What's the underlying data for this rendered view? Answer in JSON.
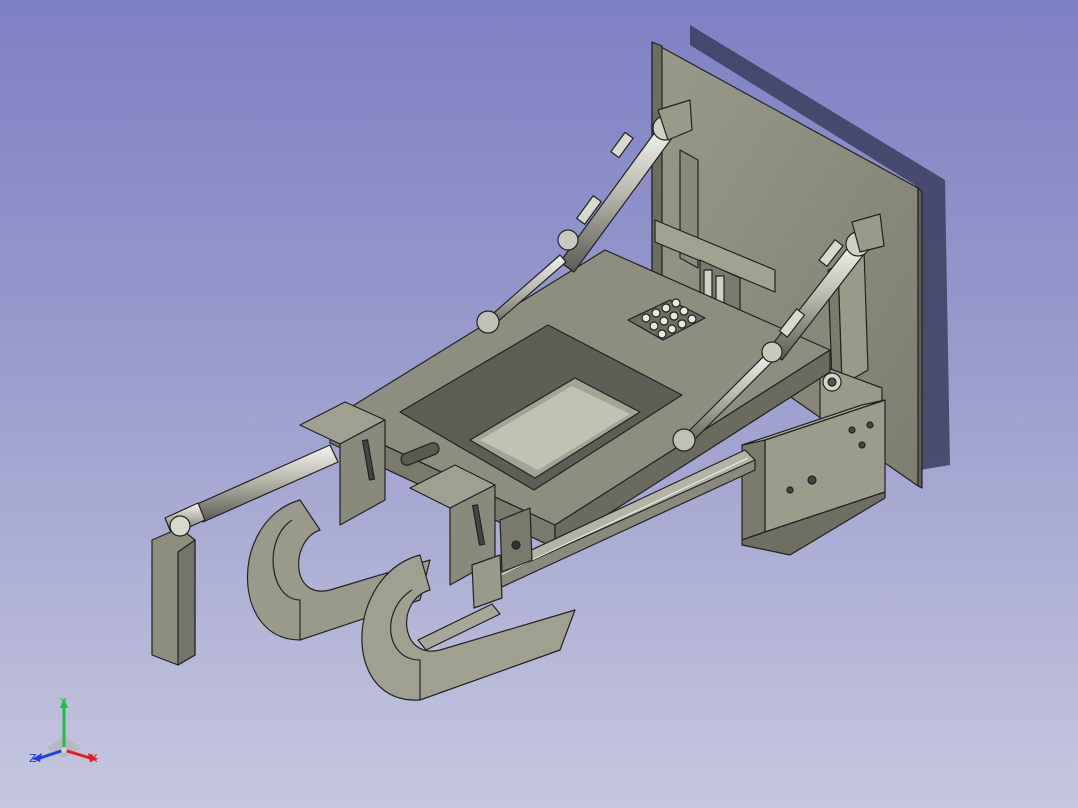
{
  "viewer": {
    "background_top": "#7e80c4",
    "background_bottom": "#c6c7de",
    "part_color": "#8c8c7c",
    "edge_color": "#222222"
  },
  "triad": {
    "x_label": "X",
    "y_label": "Y",
    "z_label": "Z",
    "x_color": "#e0201e",
    "y_color": "#20c040",
    "z_color": "#2040e0"
  }
}
